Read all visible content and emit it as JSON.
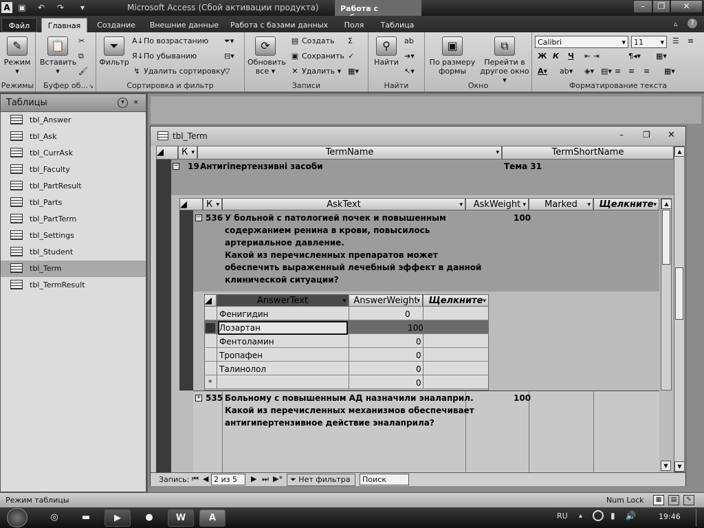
{
  "window": {
    "title": "Microsoft Access (Сбой активации продукта)",
    "context_tab_group": "Работа с таблицами",
    "controls": {
      "minimize": "–",
      "restore": "❐",
      "close": "✕"
    }
  },
  "ribbon_tabs": [
    {
      "label": "Файл"
    },
    {
      "label": "Главная"
    },
    {
      "label": "Создание"
    },
    {
      "label": "Внешние данные"
    },
    {
      "label": "Работа с базами данных"
    },
    {
      "label": "Поля"
    },
    {
      "label": "Таблица"
    }
  ],
  "ribbon": {
    "groups": {
      "modes": "Режимы",
      "clipboard": "Буфер об...",
      "sort_filter": "Сортировка и фильтр",
      "records": "Записи",
      "find": "Найти",
      "window": "Окно",
      "text_format": "Форматирование текста"
    },
    "mode_btn": "Режим",
    "paste_btn": "Вставить",
    "filter_btn": "Фильтр",
    "sort_asc": "По возрастанию",
    "sort_desc": "По убыванию",
    "remove_sort": "Удалить сортировку",
    "refresh_btn_1": "Обновить",
    "refresh_btn_2": "все",
    "create_rec": "Создать",
    "save_rec": "Сохранить",
    "delete_rec": "Удалить",
    "find_btn": "Найти",
    "fit_form_1": "По размеру",
    "fit_form_2": "формы",
    "switch_win_1": "Перейти в",
    "switch_win_2": "другое окно",
    "font_name": "Calibri",
    "font_size": "11",
    "bold": "Ж",
    "italic": "К",
    "underline": "Ч"
  },
  "nav_pane": {
    "title": "Таблицы",
    "items": [
      {
        "label": "tbl_Answer"
      },
      {
        "label": "tbl_Ask"
      },
      {
        "label": "tbl_CurrAsk"
      },
      {
        "label": "tbl_Faculty"
      },
      {
        "label": "tbl_PartResult"
      },
      {
        "label": "tbl_Parts"
      },
      {
        "label": "tbl_PartTerm"
      },
      {
        "label": "tbl_Settings"
      },
      {
        "label": "tbl_Student"
      },
      {
        "label": "tbl_Term"
      },
      {
        "label": "tbl_TermResult"
      }
    ]
  },
  "document": {
    "title": "tbl_Term",
    "term_headers": {
      "k": "К",
      "term_name": "TermName",
      "short_name": "TermShortName"
    },
    "term_row": {
      "id": "19",
      "name": "Антигіпертензивні засоби",
      "short": "Тема 31"
    },
    "ask_headers": {
      "k": "К",
      "ask_text": "AskText",
      "weight": "AskWeight",
      "marked": "Marked",
      "click": "Щелкните"
    },
    "ask_row_1": {
      "id": "536",
      "lines": [
        "У больной с патологией почек и повышенным",
        "содержанием ренина в крови, повысилось",
        "артериальное давление.",
        "Какой из перечисленных препаратов может",
        "обеспечить выраженный лечебный эффект в данной",
        "клинической ситуации?"
      ],
      "weight": "100"
    },
    "answer_headers": {
      "text": "AnswerText",
      "weight": "AnswerWeight",
      "click": "Щелкните"
    },
    "answers": [
      {
        "text": "Фенигидин",
        "weight": "0"
      },
      {
        "text": "Лозартан",
        "weight": "100"
      },
      {
        "text": "Фентоламин",
        "weight": "0"
      },
      {
        "text": "Тропафен",
        "weight": "0"
      },
      {
        "text": "Талинолол",
        "weight": "0"
      }
    ],
    "new_row": {
      "marker": "*",
      "weight": "0"
    },
    "ask_row_2": {
      "id": "535",
      "lines": [
        "Больному с повышенным АД назначили эналаприл.",
        "Какой из перечисленных механизмов обеспечивает",
        "антигипертензивное действие эналаприла?"
      ],
      "weight": "100"
    },
    "record_nav": {
      "label": "Запись:",
      "position": "2 из 5",
      "filter": "Нет фильтра",
      "search": "Поиск"
    }
  },
  "status": {
    "mode": "Режим таблицы",
    "numlock": "Num Lock"
  },
  "taskbar": {
    "lang": "RU",
    "time": "19:46",
    "app1": "W",
    "app2": "A"
  }
}
